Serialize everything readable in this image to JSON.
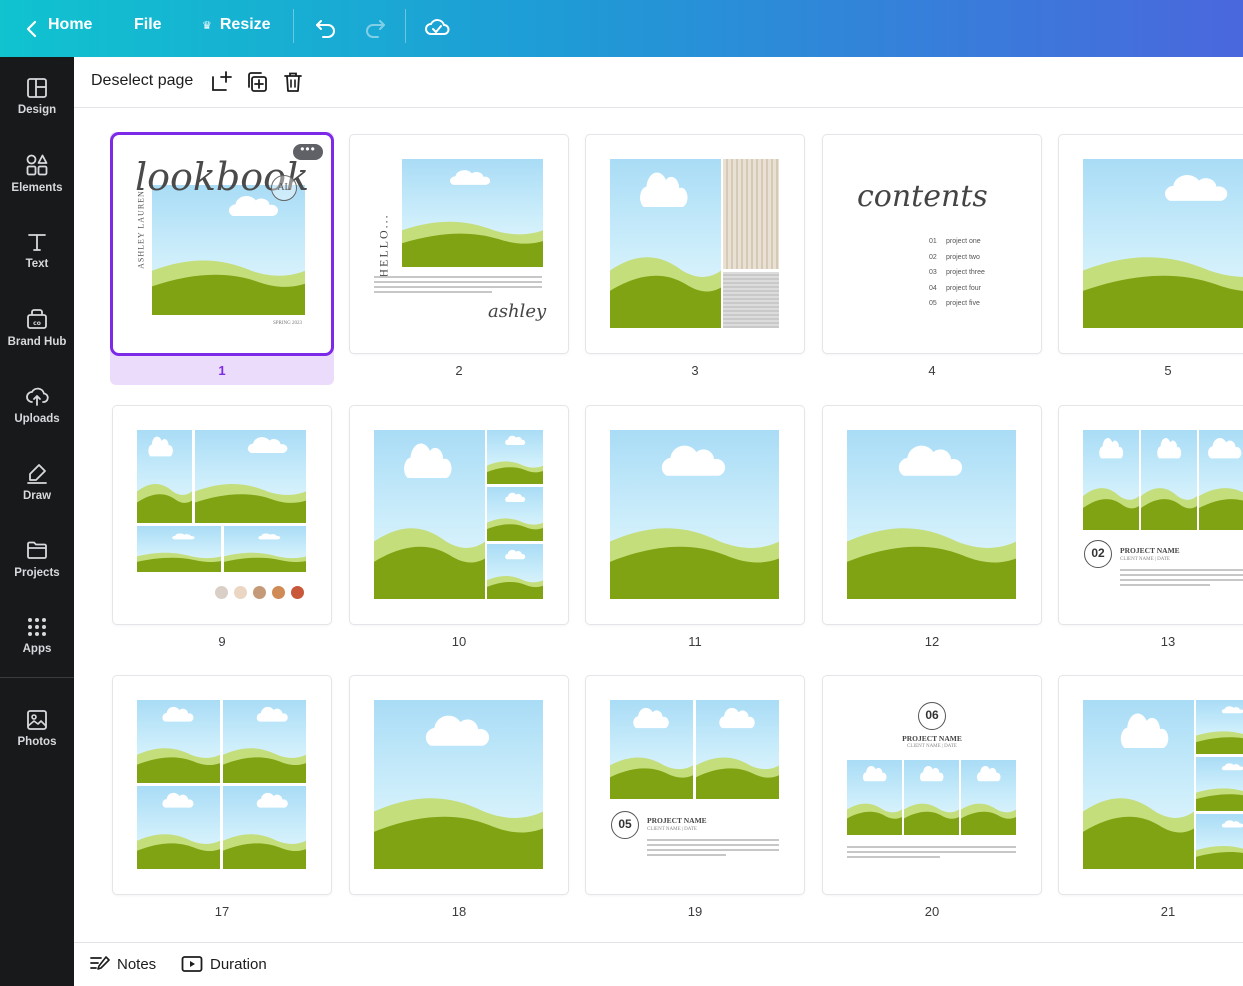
{
  "topbar": {
    "home_label": "Home",
    "file_label": "File",
    "resize_label": "Resize",
    "resize_icon": "crown-icon"
  },
  "sidebar": {
    "items": [
      {
        "label": "Design",
        "icon": "layout-icon"
      },
      {
        "label": "Elements",
        "icon": "shapes-icon"
      },
      {
        "label": "Text",
        "icon": "text-icon"
      },
      {
        "label": "Brand Hub",
        "icon": "brand-hub-icon"
      },
      {
        "label": "Uploads",
        "icon": "upload-cloud-icon"
      },
      {
        "label": "Draw",
        "icon": "draw-icon"
      },
      {
        "label": "Projects",
        "icon": "folder-icon"
      },
      {
        "label": "Apps",
        "icon": "apps-grid-icon"
      },
      {
        "label": "Photos",
        "icon": "photo-icon"
      }
    ]
  },
  "pagebar": {
    "deselect_label": "Deselect page"
  },
  "pages": {
    "p1": {
      "number": "1",
      "script_title": "lookbook",
      "name_vertical": "ASHLEY LAUREN",
      "monogram": "AL",
      "footer": "SPRING 2023",
      "more": "•••"
    },
    "p2": {
      "number": "2",
      "vertical_title": "HELLO...",
      "signature": "ashley"
    },
    "p3": {
      "number": "3"
    },
    "p4": {
      "number": "4",
      "script_title": "contents",
      "entries": [
        {
          "num": "01",
          "label": "project one"
        },
        {
          "num": "02",
          "label": "project two"
        },
        {
          "num": "03",
          "label": "project three"
        },
        {
          "num": "04",
          "label": "project four"
        },
        {
          "num": "05",
          "label": "project five"
        }
      ]
    },
    "p5": {
      "number": "5"
    },
    "p9": {
      "number": "9",
      "swatches": [
        "#d9cfc6",
        "#ead6c2",
        "#c49a78",
        "#cf8a55",
        "#c9573a"
      ]
    },
    "p10": {
      "number": "10"
    },
    "p11": {
      "number": "11"
    },
    "p12": {
      "number": "12"
    },
    "p13": {
      "number": "13",
      "badge": "02",
      "project_name": "PROJECT NAME",
      "client_line": "CLIENT NAME | DATE"
    },
    "p17": {
      "number": "17"
    },
    "p18": {
      "number": "18"
    },
    "p19": {
      "number": "19",
      "badge": "05",
      "project_name": "PROJECT NAME",
      "client_line": "CLIENT NAME | DATE"
    },
    "p20": {
      "number": "20",
      "badge": "06",
      "project_name": "PROJECT NAME",
      "client_line": "CLIENT NAME | DATE"
    },
    "p21": {
      "number": "21"
    }
  },
  "bottombar": {
    "notes_label": "Notes",
    "duration_label": "Duration"
  },
  "colors": {
    "accent": "#7d2ae8",
    "sky": "#cdeefb",
    "hill_dark": "#7fa312",
    "hill_light": "#c4de7c"
  }
}
